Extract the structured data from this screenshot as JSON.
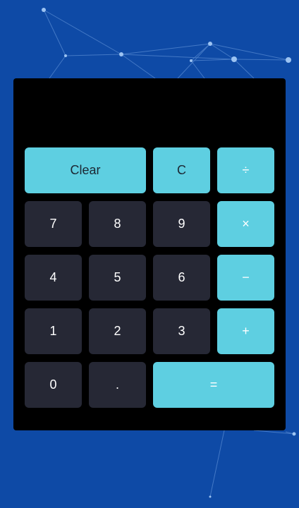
{
  "theme": {
    "background": "#0e4aa6",
    "panel": "#000000",
    "number_button": "#262835",
    "accent_button": "#5ecfe1"
  },
  "display": {
    "value": ""
  },
  "buttons": {
    "clear": "Clear",
    "c": "C",
    "divide": "÷",
    "seven": "7",
    "eight": "8",
    "nine": "9",
    "multiply": "×",
    "four": "4",
    "five": "5",
    "six": "6",
    "subtract": "−",
    "one": "1",
    "two": "2",
    "three": "3",
    "add": "+",
    "zero": "0",
    "decimal": ".",
    "equals": "="
  }
}
